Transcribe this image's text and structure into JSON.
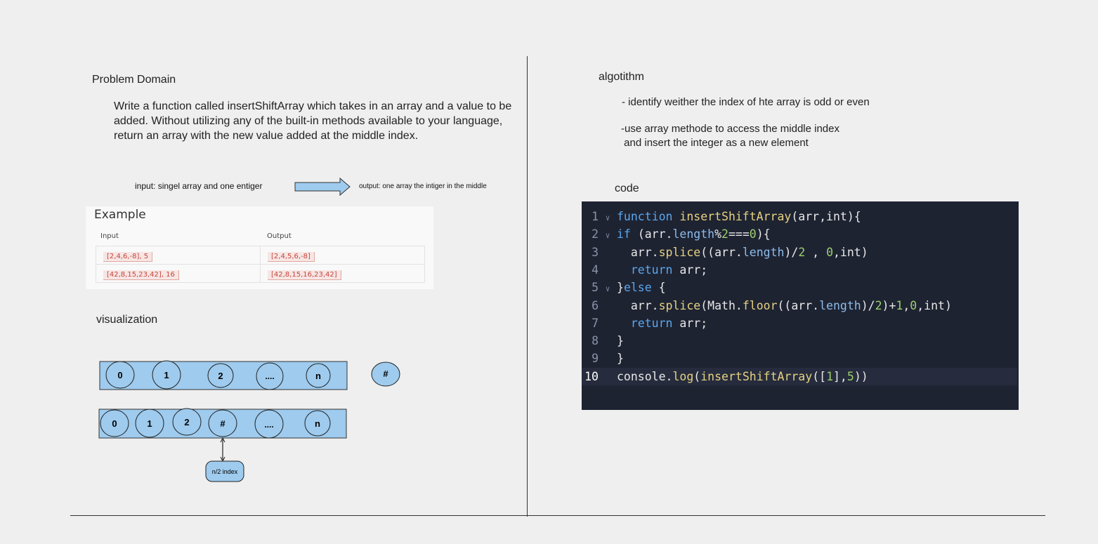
{
  "problem": {
    "heading": "Problem Domain",
    "text": "Write a function called insertShiftArray which takes in an array and a value to be added. Without utilizing any of the built-in methods available to your language, return an array with the new value added at the middle index.",
    "input_label": "input: singel array and one entiger",
    "output_label": "output: one array the intiger in the middle"
  },
  "example": {
    "title": "Example",
    "headers": [
      "Input",
      "Output"
    ],
    "rows": [
      [
        "[2,4,6,-8], 5",
        "[2,4,5,6,-8]"
      ],
      [
        "[42,8,15,23,42], 16",
        "[42,8,15,16,23,42]"
      ]
    ]
  },
  "visualization": {
    "heading": "visualization",
    "row1": [
      "0",
      "1",
      "2",
      "....",
      "n"
    ],
    "new_item": "#",
    "row2": [
      "0",
      "1",
      "2",
      "#",
      "....",
      "n"
    ],
    "index_label": "n/2 index",
    "fill": "#9ecbee"
  },
  "algorithm": {
    "heading": "algotithm",
    "step1": "- identify weither the index of hte  array is odd or even",
    "step2a": "-use array methode to access the middle index",
    "step2b": " and insert the integer as a new element"
  },
  "code": {
    "heading": "code",
    "highlight_line": 10,
    "lines": [
      {
        "num": "1",
        "fold": true,
        "seg": [
          [
            "k",
            "function "
          ],
          [
            "f",
            "insertShiftArray"
          ],
          [
            "t",
            "(arr,int){"
          ]
        ]
      },
      {
        "num": "2",
        "fold": true,
        "seg": [
          [
            "k",
            "if "
          ],
          [
            "t",
            "(arr."
          ],
          [
            "pr",
            "length"
          ],
          [
            "t",
            "%"
          ],
          [
            "n",
            "2"
          ],
          [
            "t",
            "==="
          ],
          [
            "n",
            "0"
          ],
          [
            "t",
            "){"
          ]
        ]
      },
      {
        "num": "3",
        "fold": false,
        "seg": [
          [
            "t",
            "  arr."
          ],
          [
            "f",
            "splice"
          ],
          [
            "t",
            "((arr."
          ],
          [
            "pr",
            "length"
          ],
          [
            "t",
            ")/"
          ],
          [
            "n",
            "2"
          ],
          [
            "t",
            " , "
          ],
          [
            "n",
            "0"
          ],
          [
            "t",
            ",int)"
          ]
        ]
      },
      {
        "num": "4",
        "fold": false,
        "seg": [
          [
            "t",
            "  "
          ],
          [
            "k",
            "return "
          ],
          [
            "t",
            "arr;"
          ]
        ]
      },
      {
        "num": "5",
        "fold": true,
        "seg": [
          [
            "t",
            "}"
          ],
          [
            "k",
            "else "
          ],
          [
            "t",
            "{"
          ]
        ]
      },
      {
        "num": "6",
        "fold": false,
        "seg": [
          [
            "t",
            "  arr."
          ],
          [
            "f",
            "splice"
          ],
          [
            "t",
            "(Math."
          ],
          [
            "f",
            "floor"
          ],
          [
            "t",
            "((arr."
          ],
          [
            "pr",
            "length"
          ],
          [
            "t",
            ")/"
          ],
          [
            "n",
            "2"
          ],
          [
            "t",
            ")+"
          ],
          [
            "n",
            "1"
          ],
          [
            "t",
            ","
          ],
          [
            "n",
            "0"
          ],
          [
            "t",
            ",int)"
          ]
        ]
      },
      {
        "num": "7",
        "fold": false,
        "seg": [
          [
            "t",
            "  "
          ],
          [
            "k",
            "return "
          ],
          [
            "t",
            "arr;"
          ]
        ]
      },
      {
        "num": "8",
        "fold": false,
        "seg": [
          [
            "t",
            "}"
          ]
        ]
      },
      {
        "num": "9",
        "fold": false,
        "seg": [
          [
            "t",
            "}"
          ]
        ]
      },
      {
        "num": "10",
        "fold": false,
        "seg": [
          [
            "t",
            "console."
          ],
          [
            "f",
            "log"
          ],
          [
            "t",
            "("
          ],
          [
            "f",
            "insertShiftArray"
          ],
          [
            "t",
            "(["
          ],
          [
            "n",
            "1"
          ],
          [
            "t",
            "],"
          ],
          [
            "n",
            "5"
          ],
          [
            "t",
            "))"
          ]
        ]
      }
    ]
  }
}
